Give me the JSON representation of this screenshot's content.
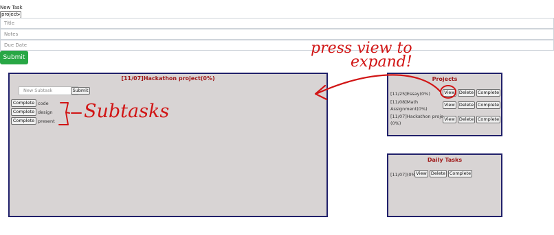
{
  "form": {
    "label": "New Task",
    "type_value": "project",
    "title_placeholder": "Title",
    "notes_placeholder": "Notes",
    "due_placeholder": "Due Date",
    "submit_label": "Submit"
  },
  "detail": {
    "title": "[11/07]Hackathon project(0%)",
    "subtask_placeholder": "New Subtask",
    "submit_label": "Submit",
    "subtasks": [
      {
        "button": "Complete",
        "name": "code"
      },
      {
        "button": "Complete",
        "name": "design"
      },
      {
        "button": "Complete",
        "name": "present"
      }
    ]
  },
  "projects": {
    "title": "Projects",
    "items": [
      {
        "line1": "[11/25]Essay(0%)",
        "line2": "",
        "view": "View",
        "delete": "Delete",
        "complete": "Complete"
      },
      {
        "line1": "[11/08]Math",
        "line2": "Assignment(0%)",
        "view": "View",
        "delete": "Delete",
        "complete": "Complete"
      },
      {
        "line1": "[11/07]Hackathon proje...",
        "line2": "(0%)",
        "view": "View",
        "delete": "Delete",
        "complete": "Complete"
      }
    ]
  },
  "daily": {
    "title": "Daily Tasks",
    "items": [
      {
        "label": "[11/07](0%)",
        "view": "View",
        "delete": "Delete",
        "complete": "Complete"
      }
    ]
  },
  "annotations": {
    "line1": "press view to",
    "line2": "expand!",
    "subtasks": "Subtasks",
    "color": "#d11515"
  }
}
